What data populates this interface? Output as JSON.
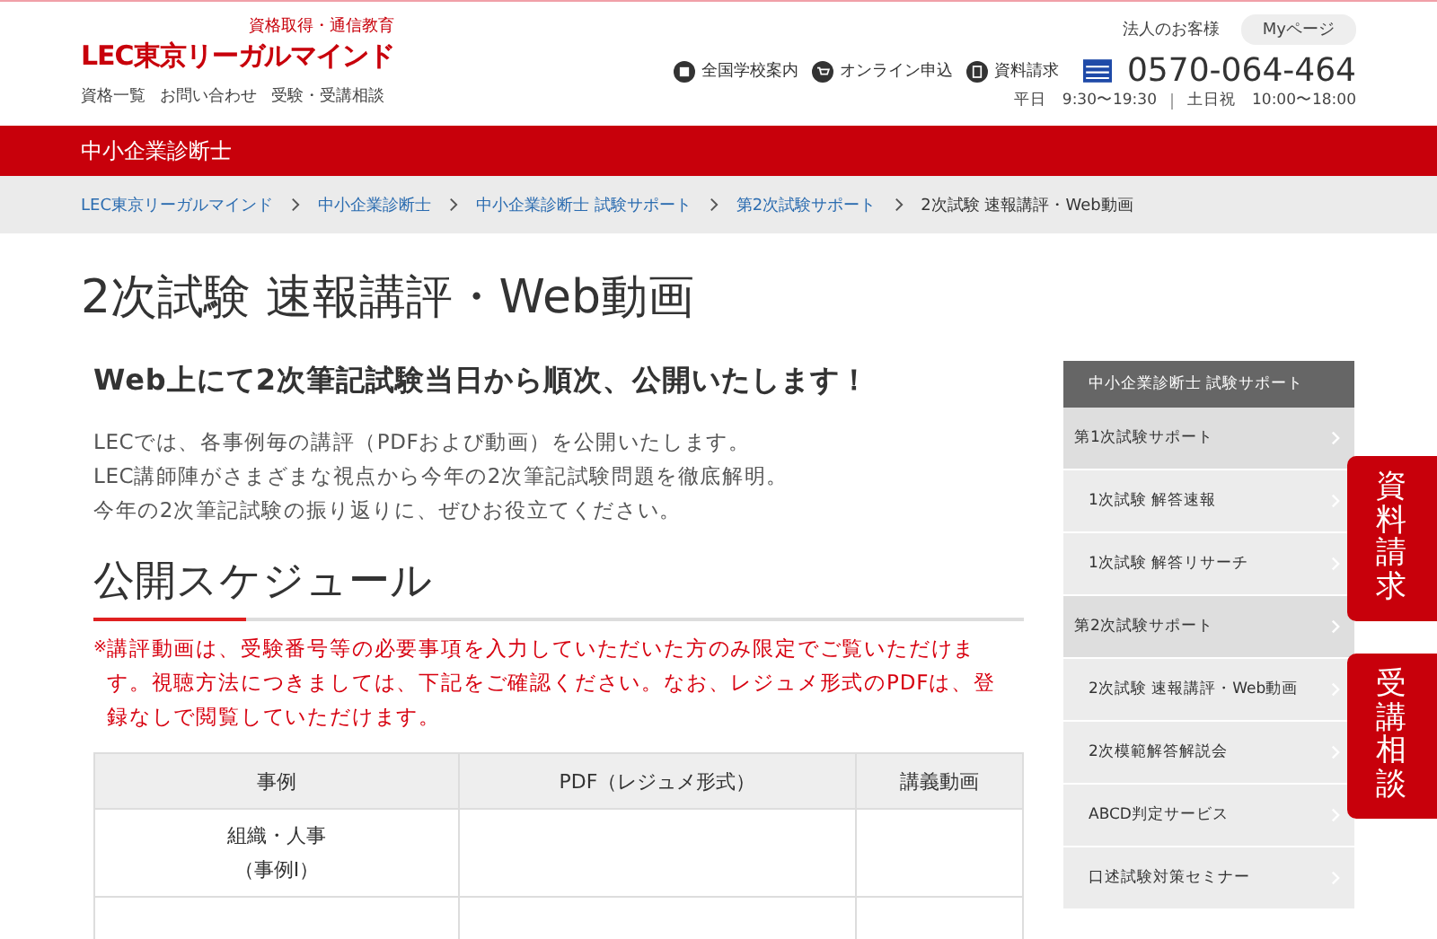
{
  "header": {
    "tagline": "資格取得・通信教育",
    "logo": "LEC東京リーガルマインド",
    "links": [
      "資格一覧",
      "お問い合わせ",
      "受験・受講相談"
    ],
    "corporate": "法人のお客様",
    "mypage": "Myページ",
    "utility": [
      {
        "kind": "school",
        "label": "全国学校案内"
      },
      {
        "kind": "cart",
        "label": "オンライン申込"
      },
      {
        "kind": "doc",
        "label": "資料請求"
      }
    ],
    "phone": "0570-064-464",
    "hours": [
      "平日　9:30〜19:30",
      "土日祝　10:00〜18:00"
    ]
  },
  "category_bar": "中小企業診断士",
  "breadcrumb": [
    {
      "label": "LEC東京リーガルマインド",
      "link": true
    },
    {
      "label": "中小企業診断士",
      "link": true
    },
    {
      "label": "中小企業診断士 試験サポート",
      "link": true
    },
    {
      "label": "第2次試験サポート",
      "link": true
    },
    {
      "label": "2次試験 速報講評・Web動画",
      "link": false
    }
  ],
  "page_title": "2次試験 速報講評・Web動画",
  "lead": "Web上にて2次筆記試験当日から順次、公開いたします！",
  "intro": [
    "LECでは、各事例毎の講評（PDFおよび動画）を公開いたします。",
    "LEC講師陣がさまざまな視点から今年の2次筆記試験問題を徹底解明。",
    "今年の2次筆記試験の振り返りに、ぜひお役立てください。"
  ],
  "section_title": "公開スケジュール",
  "notice_mark": "※",
  "notice": "講評動画は、受験番号等の必要事項を入力していただいた方のみ限定でご覧いただけます。視聴方法につきましては、下記をご確認ください。なお、レジュメ形式のPDFは、登録なしで閲覧していただけます。",
  "table": {
    "columns": [
      "事例",
      "PDF（レジュメ形式）",
      "講義動画"
    ],
    "rows": [
      [
        "組織・人事（事例Ⅰ）"
      ]
    ]
  },
  "sidebar": {
    "title": "中小企業診断士 試験サポート",
    "groups": [
      {
        "label": "第1次試験サポート",
        "children": [
          {
            "label": "1次試験 解答速報"
          },
          {
            "label": "1次試験 解答リサーチ"
          }
        ]
      },
      {
        "label": "第2次試験サポート",
        "children": [
          {
            "label": "2次試験 速報講評・Web動画"
          },
          {
            "label": "2次模範解答解説会"
          },
          {
            "label": "ABCD判定サービス"
          },
          {
            "label": "口述試験対策セミナー"
          }
        ]
      }
    ]
  },
  "floating_tabs": [
    "資料請求",
    "受講相談"
  ]
}
